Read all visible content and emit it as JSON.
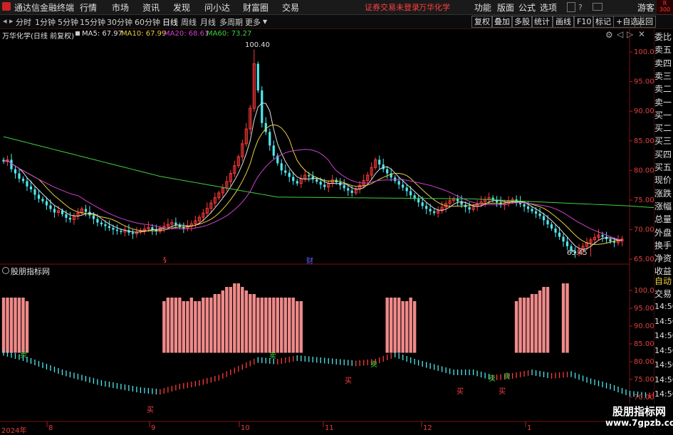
{
  "window": {
    "app_title": "通达信金融终端",
    "menu": [
      "行情",
      "市场",
      "资讯",
      "发现",
      "问小达",
      "财富圈",
      "交易"
    ],
    "login_notice": "证券交易未登录",
    "stock_name": "万华化学",
    "right_menu": [
      "功能",
      "版面",
      "公式",
      "选项"
    ],
    "guest": "游客"
  },
  "toolbar": {
    "periods": [
      "分时",
      "1分钟",
      "5分钟",
      "15分钟",
      "30分钟",
      "60分钟",
      "日线",
      "周线",
      "月线",
      "多周期",
      "更多"
    ],
    "active_period": "日线",
    "right_buttons": [
      "复权",
      "叠加",
      "多股",
      "统计",
      "画线",
      "F10",
      "标记",
      "+自选",
      "返回"
    ]
  },
  "main_chart": {
    "title": "万华化学(日线 前复权)",
    "ma_labels": [
      {
        "text": "MA5: 67.97",
        "color": "#e0e0e0"
      },
      {
        "text": "MA10: 67.99",
        "color": "#e8d040"
      },
      {
        "text": "MA20: 68.61",
        "color": "#d040d0"
      },
      {
        "text": "MA60: 73.27",
        "color": "#40d040"
      }
    ],
    "high_label": "100.40",
    "low_label": "65.45",
    "markers": [
      "§",
      "财"
    ],
    "y_ticks": [
      "100.0",
      "95.00",
      "90.00",
      "85.00",
      "80.00",
      "75.00",
      "70.00",
      "65.00"
    ]
  },
  "indicator": {
    "title": "股朋指标网",
    "y_ticks": [
      "100.0",
      "95.00",
      "90.00",
      "85.00",
      "80.00",
      "75.00",
      "70.00"
    ],
    "buy_label": "买",
    "sell_label": "卖"
  },
  "x_axis": [
    "2024年",
    "8",
    "9",
    "10",
    "11",
    "12",
    "1"
  ],
  "right_side": {
    "items": [
      "委比",
      "卖五",
      "卖四",
      "卖三",
      "卖二",
      "卖一",
      "买一",
      "买二",
      "买三",
      "买四",
      "买五",
      "现价",
      "涨跌",
      "涨幅",
      "总量",
      "外盘",
      "换手",
      "净资",
      "收益"
    ],
    "auto": "自动",
    "trade": "交易",
    "times": [
      "14:56",
      "14:56",
      "14:56",
      "14:56",
      "14:56",
      "14:56",
      "14:56",
      "14:56"
    ]
  },
  "watermark": {
    "name": "股朋指标网",
    "url": "www.7gpzb.com"
  },
  "chart_data": {
    "type": "candlestick",
    "ylim": [
      63,
      103
    ],
    "closes": [
      81.5,
      81.8,
      80.2,
      79.5,
      78.6,
      78.2,
      77.3,
      76.8,
      75.9,
      75.2,
      74.8,
      74.1,
      73.5,
      72.9,
      73.2,
      72.6,
      72.0,
      71.7,
      72.3,
      72.8,
      73.5,
      73.0,
      72.4,
      71.8,
      71.2,
      70.9,
      70.6,
      70.3,
      70.0,
      69.8,
      69.6,
      69.9,
      69.5,
      69.3,
      69.6,
      69.9,
      70.1,
      70.4,
      70.0,
      69.7,
      70.3,
      70.6,
      70.9,
      71.2,
      70.8,
      70.5,
      70.2,
      70.6,
      71.0,
      71.5,
      72.1,
      72.8,
      73.6,
      74.5,
      75.4,
      76.2,
      77.0,
      78.1,
      79.5,
      80.8,
      82.3,
      84.5,
      87.0,
      90.5,
      98.0,
      93.5,
      88.0,
      86.5,
      84.2,
      82.5,
      81.2,
      80.0,
      79.6,
      78.9,
      78.2,
      77.8,
      78.6,
      79.2,
      79.0,
      78.5,
      78.1,
      77.6,
      77.2,
      77.8,
      78.4,
      78.0,
      77.5,
      77.0,
      76.6,
      76.2,
      76.9,
      77.5,
      78.3,
      79.2,
      80.5,
      81.8,
      81.0,
      80.2,
      79.5,
      78.8,
      78.2,
      77.6,
      77.1,
      76.5,
      75.8,
      75.2,
      74.6,
      74.0,
      73.5,
      73.1,
      72.8,
      73.2,
      73.8,
      74.4,
      74.9,
      75.2,
      74.8,
      74.2,
      73.8,
      73.4,
      73.9,
      74.3,
      74.7,
      75.1,
      75.4,
      75.0,
      74.6,
      74.2,
      74.5,
      74.8,
      75.1,
      74.7,
      74.3,
      73.9,
      73.5,
      73.1,
      72.7,
      72.3,
      71.6,
      70.9,
      70.2,
      69.5,
      68.8,
      68.0,
      67.2,
      66.4,
      66.0,
      66.6,
      67.2,
      67.8,
      68.3,
      68.7,
      69.1,
      68.8,
      68.4,
      68.0,
      67.8,
      68.1,
      68.4
    ],
    "ma60_anchor": [
      [
        0,
        85.7
      ],
      [
        40,
        79.0
      ],
      [
        70,
        75.5
      ],
      [
        120,
        75.2
      ],
      [
        160,
        74.0
      ],
      [
        175,
        73.3
      ]
    ],
    "indicator_bars_groups": [
      [
        0,
        6
      ],
      [
        41,
        76
      ],
      [
        98,
        105
      ],
      [
        131,
        139
      ],
      [
        143,
        144
      ],
      [
        174,
        175
      ]
    ],
    "indicator_bar_values": [
      98,
      98,
      98,
      98,
      98,
      98,
      97,
      97,
      98,
      98,
      98,
      98,
      97,
      97,
      98,
      97,
      97,
      98,
      98,
      98,
      99,
      99,
      100,
      101,
      101,
      102,
      102,
      101,
      100,
      99,
      99,
      98,
      98,
      98,
      98
    ],
    "indicator_line_points": [
      [
        0,
        82.5
      ],
      [
        5,
        81
      ],
      [
        10,
        79
      ],
      [
        15,
        77
      ],
      [
        20,
        75.5
      ],
      [
        25,
        74
      ],
      [
        30,
        73
      ],
      [
        35,
        72
      ],
      [
        40,
        71.5
      ],
      [
        45,
        73
      ],
      [
        50,
        74
      ],
      [
        55,
        75.5
      ],
      [
        60,
        78
      ],
      [
        65,
        80.5
      ],
      [
        70,
        80
      ],
      [
        75,
        81
      ],
      [
        80,
        80.5
      ],
      [
        85,
        80
      ],
      [
        90,
        79.5
      ],
      [
        95,
        80
      ],
      [
        100,
        82
      ],
      [
        105,
        80
      ],
      [
        110,
        78.5
      ],
      [
        115,
        77
      ],
      [
        120,
        77
      ],
      [
        125,
        75.5
      ],
      [
        130,
        76
      ],
      [
        135,
        77
      ],
      [
        140,
        76
      ],
      [
        145,
        76.5
      ],
      [
        150,
        74.5
      ],
      [
        155,
        73
      ],
      [
        160,
        71
      ],
      [
        165,
        70.5
      ],
      [
        170,
        71.5
      ]
    ]
  }
}
